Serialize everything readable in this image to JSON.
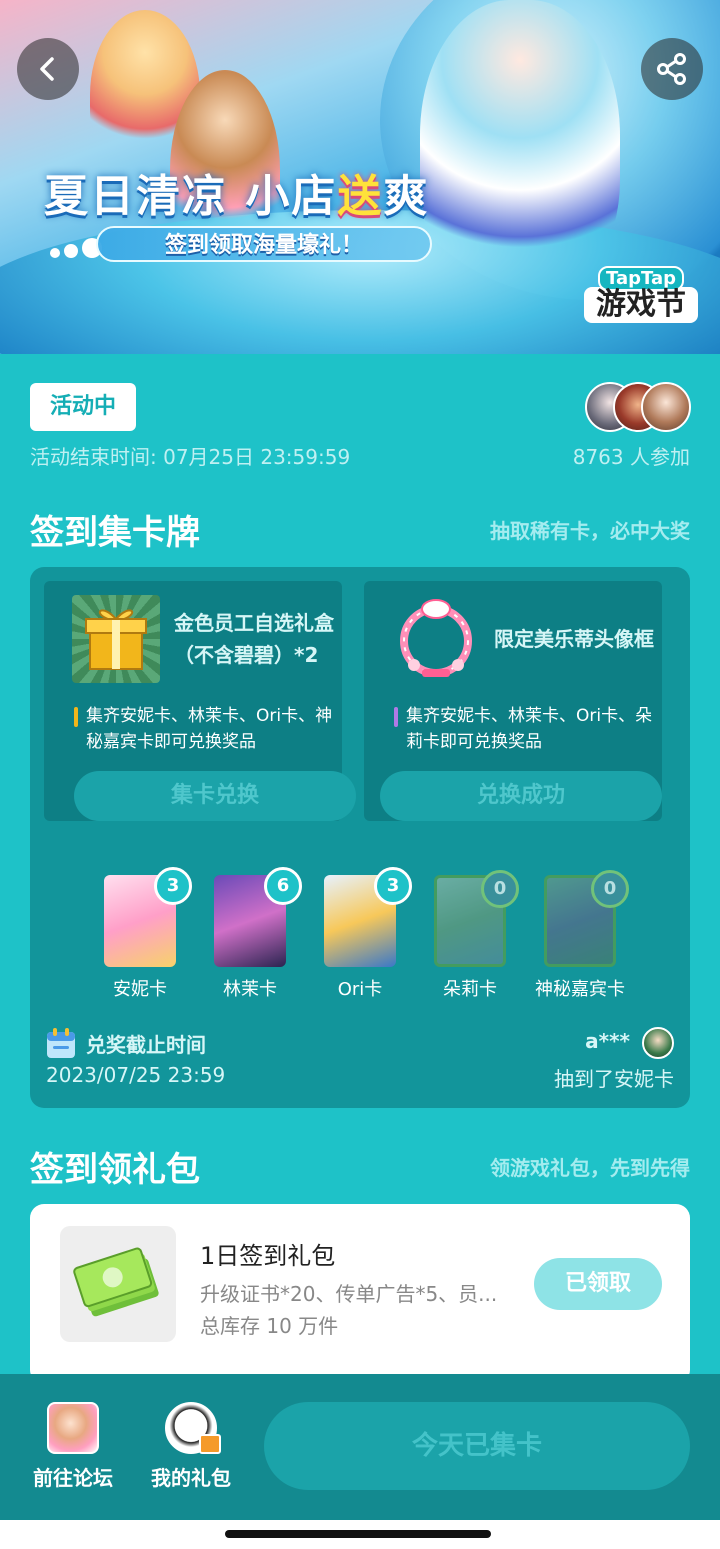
{
  "hero": {
    "title_part1": "夏日清凉 小店",
    "title_accent": "送",
    "title_part2": "爽",
    "subtitle": "签到领取海量壕礼！",
    "logo_top": "TapTap",
    "logo_bottom": "游戏节",
    "back_icon": "chevron-left-icon",
    "share_icon": "share-icon"
  },
  "activity": {
    "status": "活动中",
    "end_time": "活动结束时间: 07月25日 23:59:59",
    "participants": "8763 人参加"
  },
  "collect": {
    "title": "签到集卡牌",
    "hint": "抽取稀有卡，必中大奖",
    "rewards": [
      {
        "name": "金色员工自选礼盒（不含碧碧）*2",
        "desc": "集齐安妮卡、林茉卡、Ori卡、神秘嘉宾卡即可兑换奖品",
        "button": "集卡兑换",
        "bar_color": "#f2b61b"
      },
      {
        "name": "限定美乐蒂头像框",
        "desc": "集齐安妮卡、林茉卡、Ori卡、朵莉卡即可兑换奖品",
        "button": "兑换成功",
        "bar_color": "#b07ae6"
      }
    ],
    "cards": [
      {
        "name": "安妮卡",
        "count": "3"
      },
      {
        "name": "林茉卡",
        "count": "6"
      },
      {
        "name": "Ori卡",
        "count": "3"
      },
      {
        "name": "朵莉卡",
        "count": "0"
      },
      {
        "name": "神秘嘉宾卡",
        "count": "0"
      }
    ],
    "deadline_label": "兑奖截止时间",
    "deadline_value": "2023/07/25 23:59",
    "winner_name": "a***",
    "winner_text": "抽到了安妮卡"
  },
  "gift": {
    "title": "签到领礼包",
    "hint": "领游戏礼包，先到先得",
    "package": {
      "name": "1日签到礼包",
      "items": "升级证书*20、传单广告*5、员...",
      "stock": "总库存 10 万件",
      "button": "已领取"
    }
  },
  "bottom": {
    "forum": "前往论坛",
    "my_gifts": "我的礼包",
    "cta": "今天已集卡"
  }
}
